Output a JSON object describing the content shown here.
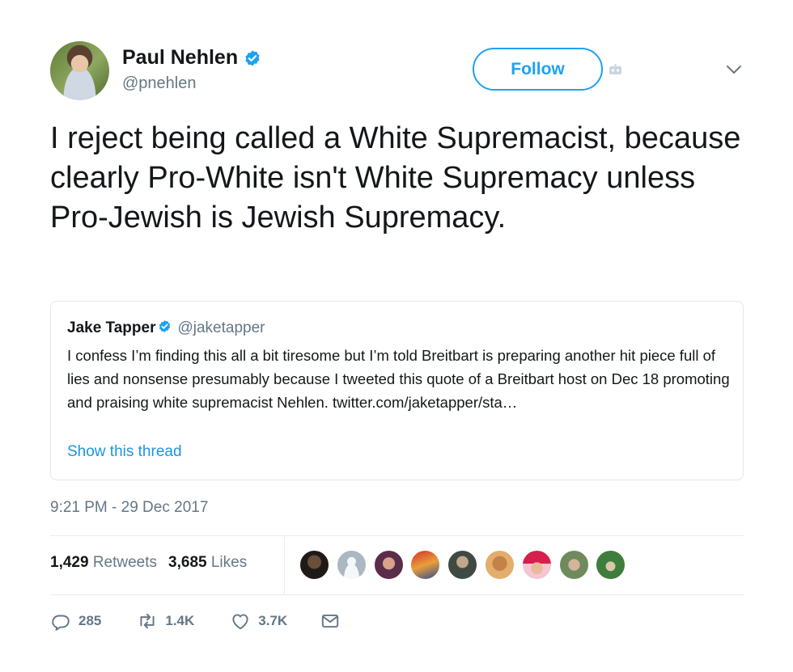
{
  "author": {
    "display_name": "Paul Nehlen",
    "handle": "@pnehlen",
    "verified": true
  },
  "follow_button": {
    "label": "Follow"
  },
  "tweet": {
    "text": "I reject being called a White Supremacist, because clearly Pro-White isn't White Supremacy unless Pro-Jewish is Jewish Supremacy.",
    "timestamp": "9:21 PM - 29 Dec 2017"
  },
  "quoted_tweet": {
    "display_name": "Jake Tapper",
    "handle": "@jaketapper",
    "verified": true,
    "text": "I confess I’m finding this all a bit tiresome but I’m told Breitbart is preparing another hit piece full of lies and nonsense presumably because I tweeted this quote of a Breitbart host on Dec 18 promoting and praising white supremacist Nehlen. twitter.com/jaketapper/sta…",
    "show_thread_label": "Show this thread"
  },
  "stats": {
    "retweets_count": "1,429",
    "retweets_label": "Retweets",
    "likes_count": "3,685",
    "likes_label": "Likes"
  },
  "actions": {
    "reply_count": "285",
    "retweet_count": "1.4K",
    "like_count": "3.7K"
  },
  "colors": {
    "accent": "#1da1f2",
    "link": "#1b95e0",
    "text_primary": "#14171a",
    "text_secondary": "#657786",
    "border": "#e1e8ed"
  },
  "icons": {
    "verified": "verified-badge-icon",
    "caret": "chevron-down-icon",
    "robot": "robot-icon",
    "reply": "reply-icon",
    "retweet": "retweet-icon",
    "like": "heart-icon",
    "dm": "envelope-icon"
  }
}
